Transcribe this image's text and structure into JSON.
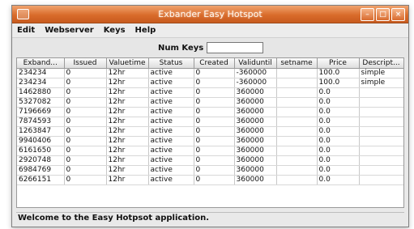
{
  "window": {
    "title": "Exbander Easy Hotspot"
  },
  "menu": {
    "items": [
      "Edit",
      "Webserver",
      "Keys",
      "Help"
    ]
  },
  "toolbar": {
    "numkeys_label": "Num Keys",
    "numkeys_value": ""
  },
  "table": {
    "columns": [
      "Exband...",
      "Issued",
      "Valuetime",
      "Status",
      "Created",
      "Validuntil",
      "setname",
      "Price",
      "Descript..."
    ],
    "rows": [
      [
        "234234",
        "0",
        "12hr",
        "active",
        "0",
        "-360000",
        "",
        "100.0",
        "simple"
      ],
      [
        "234234",
        "0",
        "12hr",
        "active",
        "0",
        "-360000",
        "",
        "100.0",
        "simple"
      ],
      [
        "1462880",
        "0",
        "12hr",
        "active",
        "0",
        "360000",
        "",
        "0.0",
        ""
      ],
      [
        "5327082",
        "0",
        "12hr",
        "active",
        "0",
        "360000",
        "",
        "0.0",
        ""
      ],
      [
        "7196669",
        "0",
        "12hr",
        "active",
        "0",
        "360000",
        "",
        "0.0",
        ""
      ],
      [
        "7874593",
        "0",
        "12hr",
        "active",
        "0",
        "360000",
        "",
        "0.0",
        ""
      ],
      [
        "1263847",
        "0",
        "12hr",
        "active",
        "0",
        "360000",
        "",
        "0.0",
        ""
      ],
      [
        "9940406",
        "0",
        "12hr",
        "active",
        "0",
        "360000",
        "",
        "0.0",
        ""
      ],
      [
        "6161650",
        "0",
        "12hr",
        "active",
        "0",
        "360000",
        "",
        "0.0",
        ""
      ],
      [
        "2920748",
        "0",
        "12hr",
        "active",
        "0",
        "360000",
        "",
        "0.0",
        ""
      ],
      [
        "6984769",
        "0",
        "12hr",
        "active",
        "0",
        "360000",
        "",
        "0.0",
        ""
      ],
      [
        "6266151",
        "0",
        "12hr",
        "active",
        "0",
        "360000",
        "",
        "0.0",
        ""
      ]
    ]
  },
  "status": {
    "message": "Welcome to the Easy Hotpsot application."
  }
}
